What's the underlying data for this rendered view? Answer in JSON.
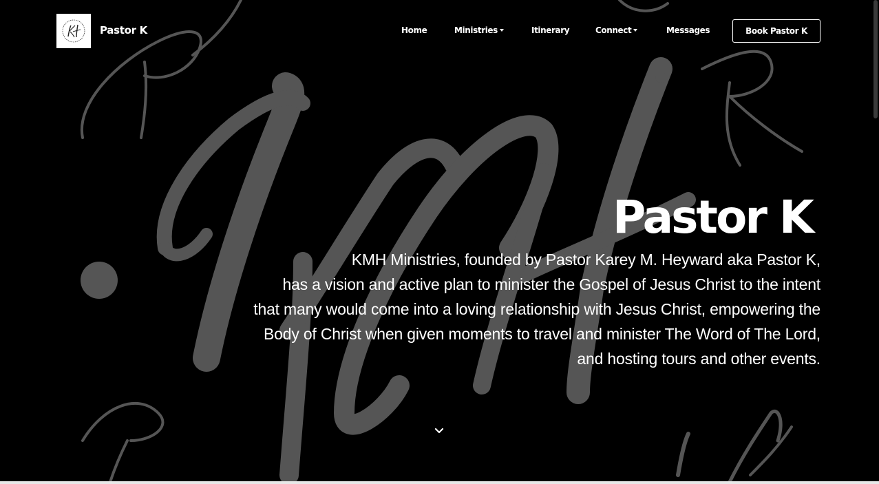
{
  "brand": {
    "name": "Pastor K",
    "logo_icon": "kh-monogram-logo"
  },
  "nav": {
    "home": "Home",
    "ministries": "Ministries",
    "itinerary": "Itinerary",
    "connect": "Connect",
    "messages": "Messages",
    "book": "Book Pastor K"
  },
  "hero": {
    "title": "Pastor K",
    "lines": [
      "KMH Ministries, founded by Pastor Karey M. Heyward aka Pastor K,",
      "has a vision and active plan to minister the Gospel of Jesus Christ  to the intent",
      "that many would come into a loving relationship with Jesus Christ, empowering the",
      "Body of Christ when given moments to travel and minister The Word of The Lord,",
      "and hosting tours and other events."
    ],
    "scroll_icon": "chevron-down-icon"
  },
  "colors": {
    "background": "#000000",
    "text": "#ffffff",
    "art": "#555555"
  }
}
